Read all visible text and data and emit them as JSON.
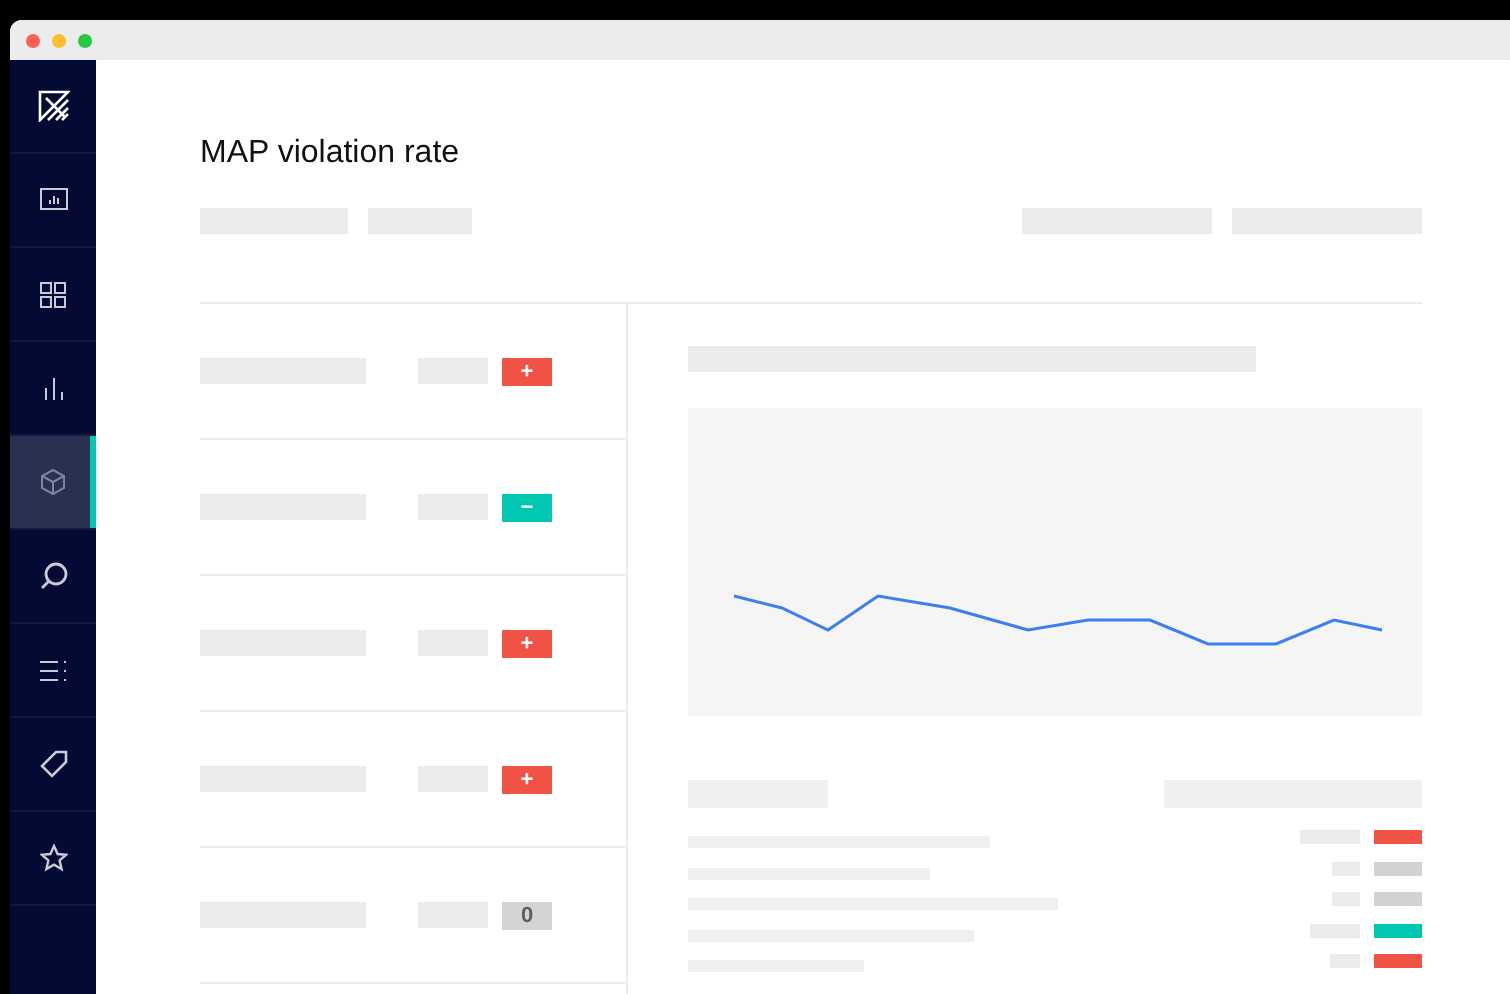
{
  "window": {
    "title": "MAP violation rate"
  },
  "sidebar": {
    "items": [
      {
        "selected": false
      },
      {
        "selected": false
      },
      {
        "selected": false
      },
      {
        "selected": true
      },
      {
        "selected": false
      },
      {
        "selected": false
      },
      {
        "selected": false
      },
      {
        "selected": false
      }
    ]
  },
  "rows": [
    {
      "badge": {
        "kind": "plus",
        "label": "+"
      }
    },
    {
      "badge": {
        "kind": "minus",
        "label": "−"
      }
    },
    {
      "badge": {
        "kind": "plus",
        "label": "+"
      }
    },
    {
      "badge": {
        "kind": "plus",
        "label": "+"
      }
    },
    {
      "badge": {
        "kind": "zero",
        "label": "0"
      }
    }
  ],
  "indicators": [
    {
      "color": "#f05246"
    },
    {
      "color": "#d2d2d2"
    },
    {
      "color": "#d2d2d2"
    },
    {
      "color": "#00c7b1"
    },
    {
      "color": "#f05246"
    }
  ]
}
